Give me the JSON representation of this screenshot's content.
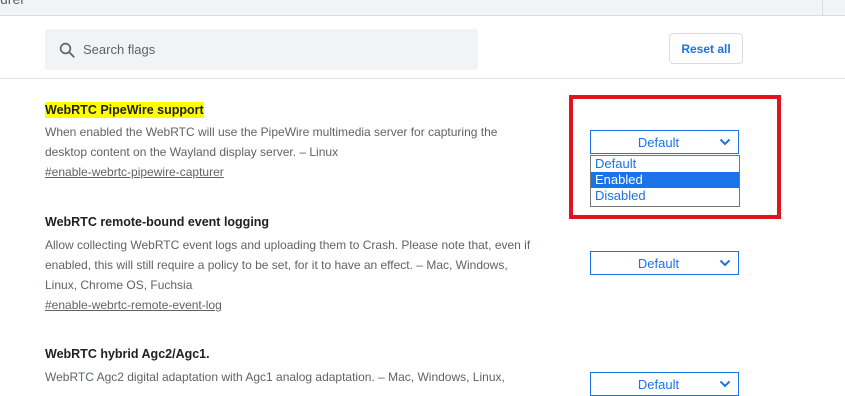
{
  "window": {
    "cut_title": "urer"
  },
  "search": {
    "placeholder": "Search flags",
    "value": ""
  },
  "toolbar": {
    "reset_label": "Reset all"
  },
  "flags": [
    {
      "title": "WebRTC PipeWire support",
      "description_line1": "When enabled the WebRTC will use the PipeWire multimedia server for capturing the",
      "description_line2": "desktop content on the Wayland display server. – Linux",
      "link": "#enable-webrtc-pipewire-capturer",
      "select_value": "Default",
      "options": [
        "Default",
        "Enabled",
        "Disabled"
      ],
      "highlighted_option": "Enabled"
    },
    {
      "title": "WebRTC remote-bound event logging",
      "description_line1": "Allow collecting WebRTC event logs and uploading them to Crash. Please note that, even if",
      "description_line2": "enabled, this will still require a policy to be set, for it to have an effect. – Mac, Windows,",
      "description_line3": "Linux, Chrome OS, Fuchsia",
      "link": "#enable-webrtc-remote-event-log",
      "select_value": "Default"
    },
    {
      "title": "WebRTC hybrid Agc2/Agc1.",
      "description_line1": "WebRTC Agc2 digital adaptation with Agc1 analog adaptation. – Mac, Windows, Linux,",
      "select_value": "Default"
    }
  ],
  "colors": {
    "accent": "#1a73e8",
    "highlight": "#ffff00",
    "annotation": "#e0141e"
  }
}
